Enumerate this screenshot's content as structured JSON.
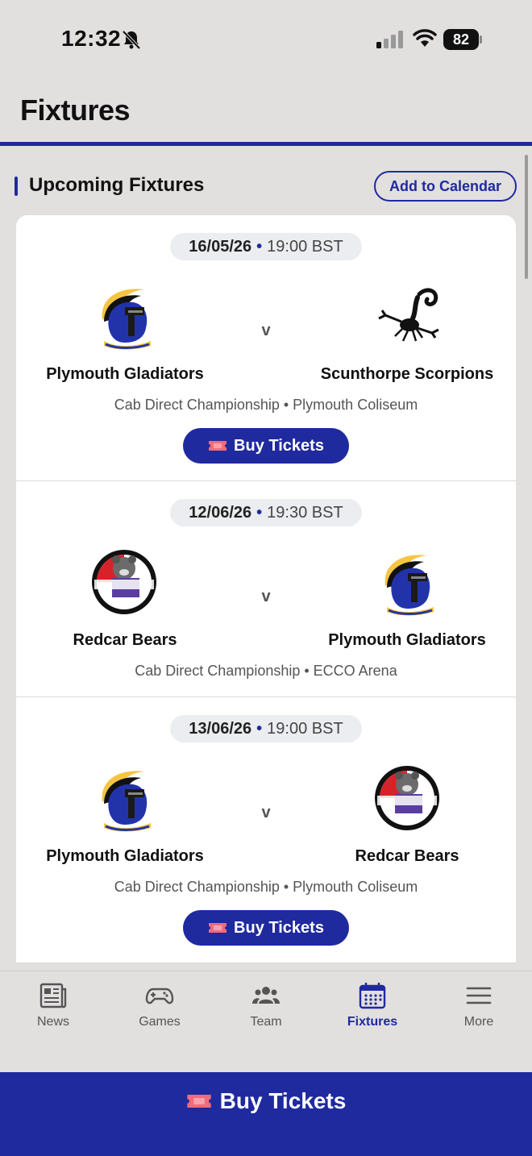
{
  "status_bar": {
    "time": "12:32",
    "battery": "82",
    "icons": [
      "bell-off-icon",
      "cellular-signal-icon",
      "wifi-icon",
      "battery-icon"
    ]
  },
  "header": {
    "title": "Fixtures"
  },
  "section": {
    "title": "Upcoming Fixtures",
    "add_to_calendar_label": "Add to Calendar"
  },
  "fixtures": [
    {
      "date": "16/05/26",
      "time": "19:00 BST",
      "home_team": "Plymouth Gladiators",
      "home_logo": "gladiator-helmet-logo",
      "away_team": "Scunthorpe Scorpions",
      "away_logo": "scorpion-logo",
      "vs": "v",
      "venue": "Cab Direct Championship • Plymouth Coliseum",
      "buy_tickets_label": "Buy Tickets"
    },
    {
      "date": "12/06/26",
      "time": "19:30 BST",
      "home_team": "Redcar Bears",
      "home_logo": "redcar-bears-logo",
      "away_team": "Plymouth Gladiators",
      "away_logo": "gladiator-helmet-logo",
      "vs": "v",
      "venue": "Cab Direct Championship • ECCO Arena"
    },
    {
      "date": "13/06/26",
      "time": "19:00 BST",
      "home_team": "Plymouth Gladiators",
      "home_logo": "gladiator-helmet-logo",
      "away_team": "Redcar Bears",
      "away_logo": "redcar-bears-logo",
      "vs": "v",
      "venue": "Cab Direct Championship • Plymouth Coliseum",
      "buy_tickets_label": "Buy Tickets"
    }
  ],
  "tabs": [
    {
      "label": "News",
      "icon": "newspaper-icon",
      "active": false
    },
    {
      "label": "Games",
      "icon": "gamepad-icon",
      "active": false
    },
    {
      "label": "Team",
      "icon": "team-icon",
      "active": false
    },
    {
      "label": "Fixtures",
      "icon": "calendar-icon",
      "active": true
    },
    {
      "label": "More",
      "icon": "menu-icon",
      "active": false
    }
  ],
  "bottom_bar": {
    "buy_tickets_label": "Buy Tickets"
  },
  "colors": {
    "brand": "#1f2a9e",
    "background": "#e2dfdf",
    "card": "#ffffff",
    "ticket": "#f06c7a"
  }
}
